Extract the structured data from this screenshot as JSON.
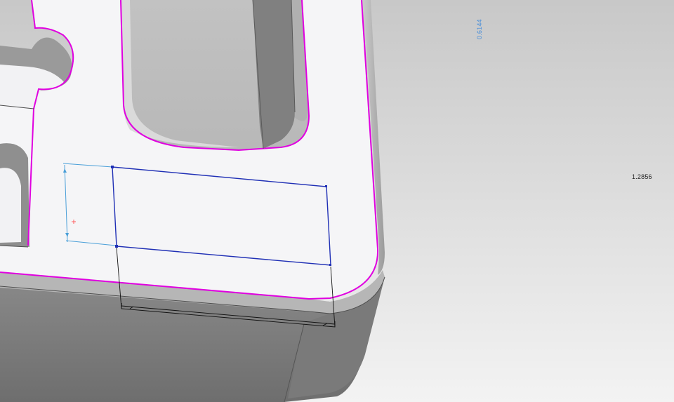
{
  "viewport": {
    "background_top": "#c9c9c9",
    "background_bottom": "#f2f2f2"
  },
  "colors": {
    "part_face": "#f4f4f6",
    "part_wall": "#7d7d7d",
    "edge_highlight": "#e000e0",
    "sketch_line": "#1f2fb5",
    "reference_line": "#4a9fd8",
    "construction_line": "#111111"
  },
  "dimensions": {
    "vertical": "0.6144",
    "horizontal": "1.2856"
  }
}
